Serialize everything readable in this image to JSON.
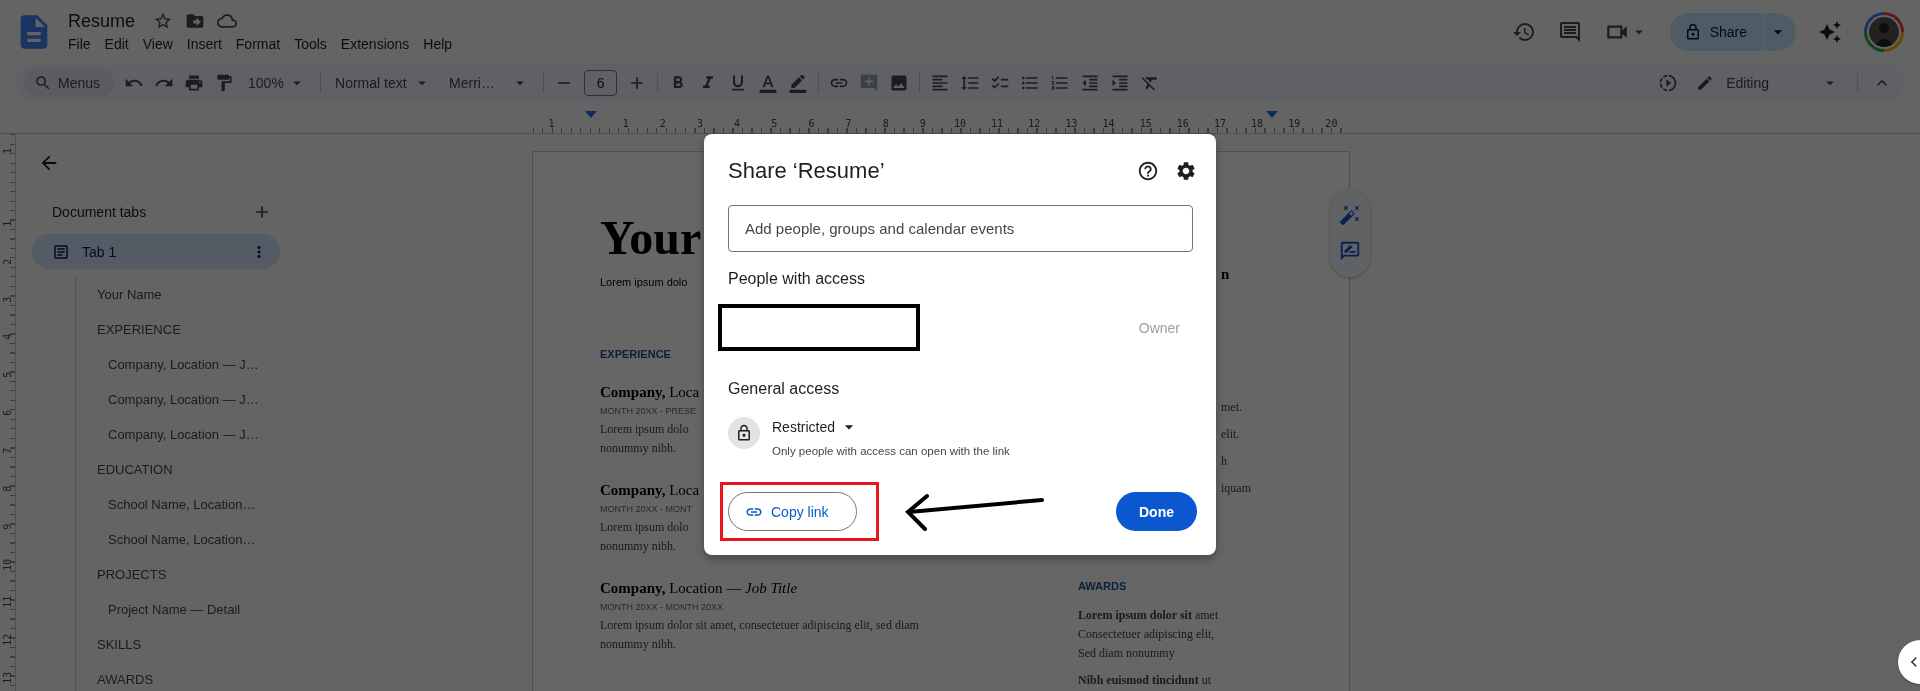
{
  "app": {
    "title": "Resume",
    "menu": [
      "File",
      "Edit",
      "View",
      "Insert",
      "Format",
      "Tools",
      "Extensions",
      "Help"
    ],
    "share_label": "Share"
  },
  "toolbar": {
    "search": "Menus",
    "zoom": "100%",
    "style": "Normal text",
    "font": "Merri…",
    "font_size": "6",
    "mode": "Editing"
  },
  "ruler": {
    "numbers": [
      "1",
      "1",
      "2",
      "3",
      "4",
      "5",
      "6",
      "7",
      "8",
      "9",
      "10",
      "11",
      "12",
      "13",
      "14",
      "15",
      "16",
      "17",
      "18",
      "19",
      "20"
    ]
  },
  "vertical_ruler": {
    "numbers": [
      "1",
      "1",
      "2",
      "3",
      "4",
      "5",
      "6",
      "7",
      "8",
      "9",
      "10",
      "11",
      "12",
      "13"
    ]
  },
  "sidebar": {
    "heading": "Document tabs",
    "tabs": [
      {
        "label": "Tab 1",
        "selected": true,
        "outline": [
          {
            "label": "Your Name"
          },
          {
            "label": "EXPERIENCE",
            "children": [
              {
                "label": "Company, Location — J…"
              },
              {
                "label": "Company, Location — J…"
              },
              {
                "label": "Company, Location — J…"
              }
            ]
          },
          {
            "label": "EDUCATION",
            "children": [
              {
                "label": "School Name, Location…"
              },
              {
                "label": "School Name, Location…"
              }
            ]
          },
          {
            "label": "PROJECTS",
            "children": [
              {
                "label": "Project Name — Detail"
              }
            ]
          },
          {
            "label": "SKILLS"
          },
          {
            "label": "AWARDS"
          }
        ]
      }
    ]
  },
  "document": {
    "left": [
      {
        "kind": "title",
        "text": "Your"
      },
      {
        "kind": "intro",
        "text": "Lorem ipsum dolo"
      },
      {
        "kind": "section",
        "text": "EXPERIENCE"
      },
      {
        "kind": "entry",
        "heading": "**Company,** Loca",
        "dates": "MONTH 20XX - PRESE",
        "lines": [
          "Lorem ipsum dolo",
          "nonummy nibh."
        ]
      },
      {
        "kind": "entry",
        "heading": "**Company,** Loca",
        "dates": "MONTH 20XX - MONT",
        "lines": [
          "Lorem ipsum dolo",
          "nonummy nibh."
        ]
      },
      {
        "kind": "entry",
        "heading": "**Company,** Location — *Job Title*",
        "dates": "MONTH 20XX - MONTH 20XX",
        "lines": [
          "Lorem ipsum dolor sit amet, consectetuer adipiscing elit, sed diam",
          "nonummy nibh."
        ]
      }
    ],
    "right": [
      {
        "kind": "heading_fragment",
        "text": "n"
      },
      {
        "kind": "fragments",
        "lines": [
          "met.",
          "elit.",
          "h",
          "iquam"
        ]
      },
      {
        "kind": "section",
        "text": "AWARDS"
      },
      {
        "kind": "paragraph",
        "lines": [
          "**Lorem ipsum dolor sit** amet",
          "Consectetuer adipiscing elit,",
          "Sed diam nonummy"
        ]
      },
      {
        "kind": "paragraph",
        "lines": [
          "**Nibh euismod tincidunt** ut"
        ]
      }
    ]
  },
  "dialog": {
    "title": "Share ‘Resume’",
    "placeholder": "Add people, groups and calendar events",
    "people_heading": "People with access",
    "people": [
      {
        "redacted": true,
        "role": "Owner"
      }
    ],
    "general_heading": "General access",
    "access": {
      "level": "Restricted",
      "description": "Only people with access can open with the link"
    },
    "copy_link": {
      "label": "Copy link",
      "highlighted": true,
      "pointer_arrow": true
    },
    "done": "Done"
  }
}
